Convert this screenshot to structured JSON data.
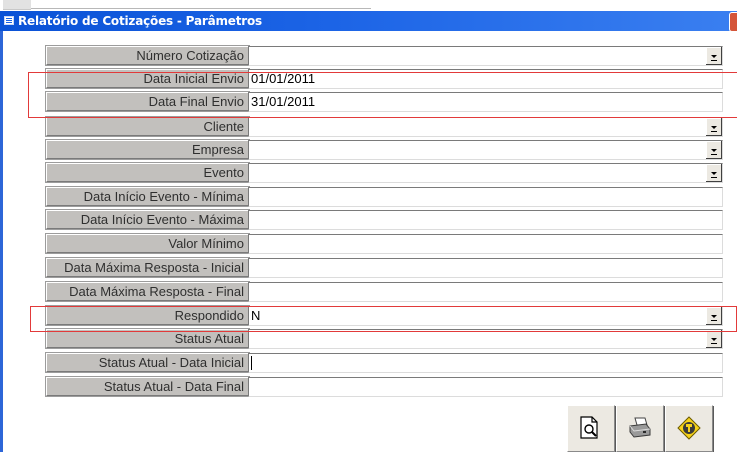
{
  "window": {
    "title": "Relatório de Cotizações - Parâmetros"
  },
  "colors": {
    "titlebar": "#1c64e6",
    "label_bg": "#c2c0bd",
    "highlight_border": "#e23a3a"
  },
  "fields": [
    {
      "label": "Número Cotização",
      "value": "",
      "type": "dropdown"
    },
    {
      "label": "Data Inicial Envio",
      "value": "01/01/2011",
      "type": "text"
    },
    {
      "label": "Data Final Envio",
      "value": "31/01/2011",
      "type": "text"
    },
    {
      "label": "Cliente",
      "value": "",
      "type": "dropdown"
    },
    {
      "label": "Empresa",
      "value": "",
      "type": "dropdown"
    },
    {
      "label": "Evento",
      "value": "",
      "type": "dropdown"
    },
    {
      "label": "Data Início Evento - Mínima",
      "value": "",
      "type": "text"
    },
    {
      "label": "Data Início Evento - Máxima",
      "value": "",
      "type": "text"
    },
    {
      "label": "Valor Mínimo",
      "value": "",
      "type": "text"
    },
    {
      "label": "Data Máxima Resposta - Inicial",
      "value": "",
      "type": "text"
    },
    {
      "label": "Data Máxima Resposta - Final",
      "value": "",
      "type": "text"
    },
    {
      "label": "Respondido",
      "value": "N",
      "type": "dropdown"
    },
    {
      "label": "Status Atual",
      "value": "",
      "type": "dropdown"
    },
    {
      "label": "Status Atual - Data Inicial",
      "value": "",
      "type": "text"
    },
    {
      "label": "Status Atual - Data Final",
      "value": "",
      "type": "text"
    }
  ],
  "toolbar": {
    "buttons": [
      {
        "name": "preview-button",
        "icon": "print-preview-icon"
      },
      {
        "name": "print-button",
        "icon": "printer-icon"
      },
      {
        "name": "exit-button",
        "icon": "exit-icon"
      }
    ]
  }
}
